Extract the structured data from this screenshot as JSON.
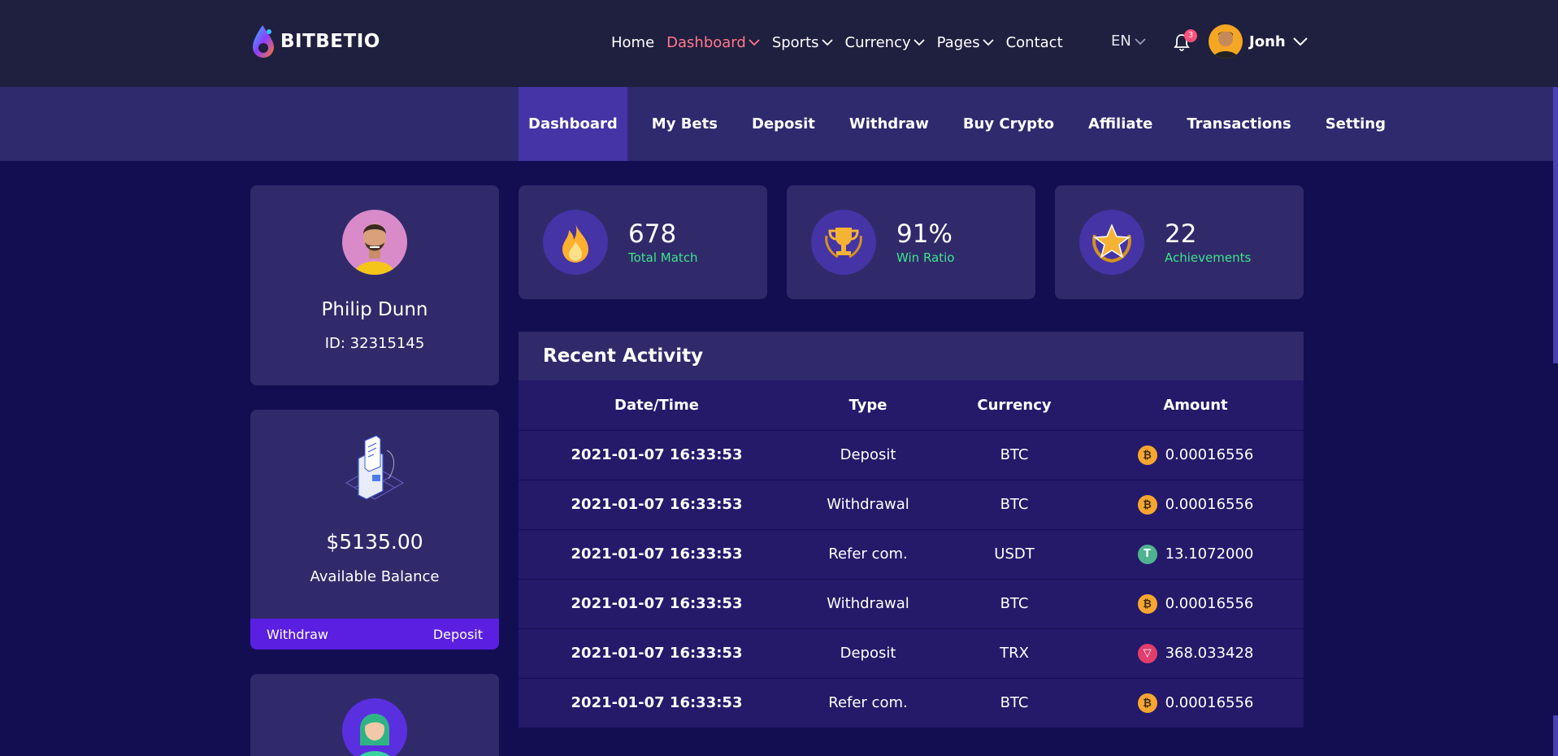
{
  "brand": {
    "name": "BITBETIO"
  },
  "nav": {
    "items": [
      {
        "label": "Home",
        "active": false,
        "dropdown": false
      },
      {
        "label": "Dashboard",
        "active": true,
        "dropdown": true
      },
      {
        "label": "Sports",
        "active": false,
        "dropdown": true
      },
      {
        "label": "Currency",
        "active": false,
        "dropdown": true
      },
      {
        "label": "Pages",
        "active": false,
        "dropdown": true
      },
      {
        "label": "Contact",
        "active": false,
        "dropdown": false
      }
    ],
    "lang": "EN",
    "notification_count": "3",
    "user_name": "Jonh"
  },
  "subnav": {
    "items": [
      "Dashboard",
      "My Bets",
      "Deposit",
      "Withdraw",
      "Buy Crypto",
      "Affiliate",
      "Transactions",
      "Setting"
    ],
    "active": "Dashboard"
  },
  "profile": {
    "name": "Philip Dunn",
    "id": "ID: 32315145"
  },
  "balance": {
    "amount": "$5135.00",
    "label": "Available Balance",
    "withdraw": "Withdraw",
    "deposit": "Deposit"
  },
  "stats": [
    {
      "value": "678",
      "label": "Total Match",
      "icon": "fire-icon"
    },
    {
      "value": "91%",
      "label": "Win Ratio",
      "icon": "trophy-icon"
    },
    {
      "value": "22",
      "label": "Achievements",
      "icon": "star-badge-icon"
    }
  ],
  "activity": {
    "title": "Recent Activity",
    "columns": [
      "Date/Time",
      "Type",
      "Currency",
      "Amount"
    ],
    "rows": [
      {
        "datetime": "2021-01-07 16:33:53",
        "type": "Deposit",
        "currency": "BTC",
        "amount": "0.00016556",
        "coin": "btc"
      },
      {
        "datetime": "2021-01-07 16:33:53",
        "type": "Withdrawal",
        "currency": "BTC",
        "amount": "0.00016556",
        "coin": "btc"
      },
      {
        "datetime": "2021-01-07 16:33:53",
        "type": "Refer com.",
        "currency": "USDT",
        "amount": "13.1072000",
        "coin": "usdt"
      },
      {
        "datetime": "2021-01-07 16:33:53",
        "type": "Withdrawal",
        "currency": "BTC",
        "amount": "0.00016556",
        "coin": "btc"
      },
      {
        "datetime": "2021-01-07 16:33:53",
        "type": "Deposit",
        "currency": "TRX",
        "amount": "368.033428",
        "coin": "trx"
      },
      {
        "datetime": "2021-01-07 16:33:53",
        "type": "Refer com.",
        "currency": "BTC",
        "amount": "0.00016556",
        "coin": "btc"
      }
    ]
  },
  "colors": {
    "accent": "#ff7a8a",
    "green": "#3ee58a",
    "btc": "#f7a630",
    "usdt": "#4db391",
    "trx": "#e23d6d"
  }
}
